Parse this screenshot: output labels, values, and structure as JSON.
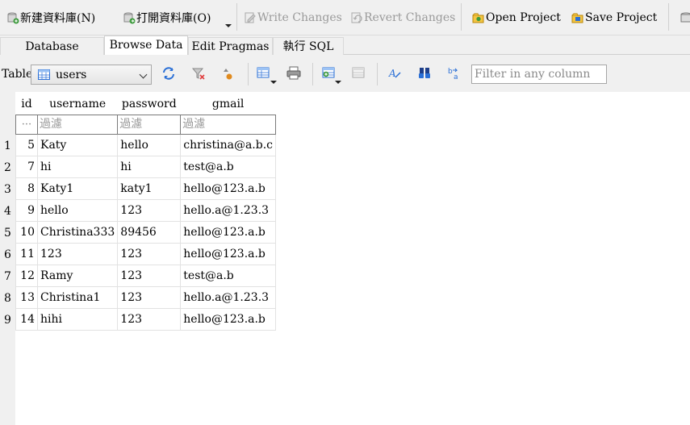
{
  "toolbar": {
    "new_db": "新建資料庫(N)",
    "open_db": "打開資料庫(O)",
    "write_changes": "Write Changes",
    "revert_changes": "Revert Changes",
    "open_project": "Open Project",
    "save_project": "Save Project"
  },
  "tabs": [
    {
      "label": "Database Structure",
      "active": false
    },
    {
      "label": "Browse Data",
      "active": true
    },
    {
      "label": "Edit Pragmas",
      "active": false
    },
    {
      "label": "執行 SQL",
      "active": false
    }
  ],
  "browse": {
    "table_label": "Table:",
    "selected_table": "users",
    "filter_placeholder": "Filter in any column"
  },
  "grid": {
    "columns": [
      "id",
      "username",
      "password",
      "gmail"
    ],
    "filter_placeholder": "過濾",
    "filter_dots": "···",
    "rows": [
      {
        "rownum": "1",
        "id": "5",
        "username": "Katy",
        "password": "hello",
        "gmail": "christina@a.b.c"
      },
      {
        "rownum": "2",
        "id": "7",
        "username": "hi",
        "password": "hi",
        "gmail": "test@a.b"
      },
      {
        "rownum": "3",
        "id": "8",
        "username": "Katy1",
        "password": "katy1",
        "gmail": "hello@123.a.b"
      },
      {
        "rownum": "4",
        "id": "9",
        "username": "hello",
        "password": "123",
        "gmail": "hello.a@1.23.3"
      },
      {
        "rownum": "5",
        "id": "10",
        "username": "Christina333",
        "password": "89456",
        "gmail": "hello@123.a.b"
      },
      {
        "rownum": "6",
        "id": "11",
        "username": "123",
        "password": "123",
        "gmail": "hello@123.a.b"
      },
      {
        "rownum": "7",
        "id": "12",
        "username": "Ramy",
        "password": "123",
        "gmail": "test@a.b"
      },
      {
        "rownum": "8",
        "id": "13",
        "username": "Christina1",
        "password": "123",
        "gmail": "hello.a@1.23.3"
      },
      {
        "rownum": "9",
        "id": "14",
        "username": "hihi",
        "password": "123",
        "gmail": "hello@123.a.b"
      }
    ]
  },
  "colors": {
    "toolbar_bg": "#f0f0f0",
    "disabled_text": "#9a9a9a",
    "icon_blue": "#2a6fd6",
    "icon_green": "#3c9a3c",
    "icon_orange": "#e08a1e"
  }
}
